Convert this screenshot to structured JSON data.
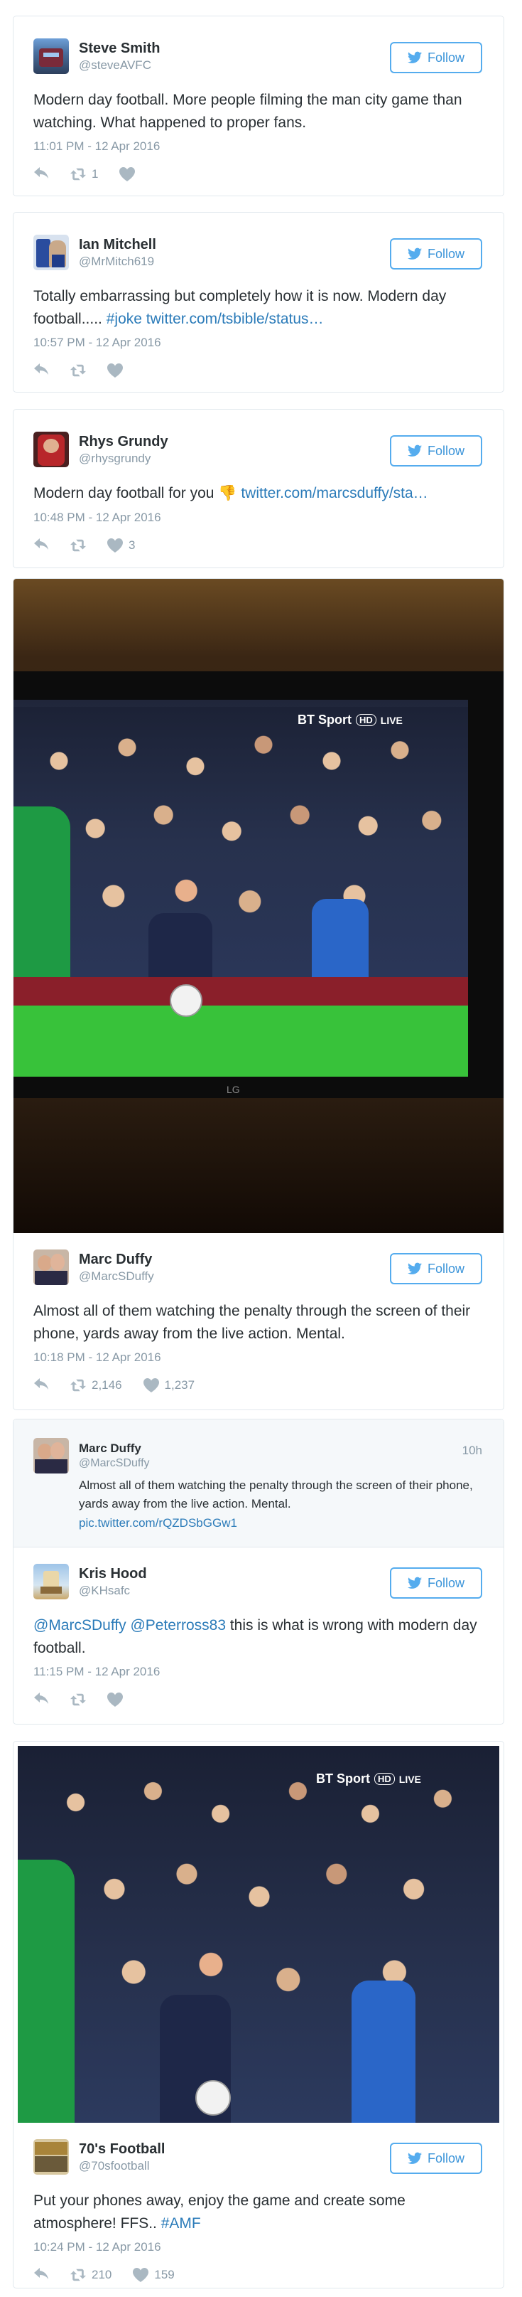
{
  "follow_label": "Follow",
  "tweets": [
    {
      "name": "Steve Smith",
      "handle": "@steveAVFC",
      "text": "Modern day football. More people filming the man city game than watching. What happened to proper fans.",
      "time": "11:01 PM - 12 Apr 2016",
      "retweets": "1",
      "likes": ""
    },
    {
      "name": "Ian Mitchell",
      "handle": "@MrMitch619",
      "text_plain": "Totally embarrassing but completely how it is now. Modern day football..... ",
      "hashtag": "#joke",
      "link": "twitter.com/tsbible/status…",
      "time": "10:57 PM - 12 Apr 2016",
      "retweets": "",
      "likes": ""
    },
    {
      "name": "Rhys Grundy",
      "handle": "@rhysgrundy",
      "text_plain": "Modern day football for you",
      "emoji": "👎",
      "link": "twitter.com/marcsduffy/sta…",
      "time": "10:48 PM - 12 Apr 2016",
      "retweets": "",
      "likes": "3"
    },
    {
      "name": "Marc Duffy",
      "handle": "@MarcSDuffy",
      "text": "Almost all of them watching the penalty through the screen of their phone, yards away from the live action. Mental.",
      "time": "10:18 PM - 12 Apr 2016",
      "retweets": "2,146",
      "likes": "1,237",
      "tv_logo": "BT Sport",
      "tv_badge": "HD",
      "tv_live": "LIVE",
      "tv_brand": "LG"
    },
    {
      "quote": {
        "name": "Marc Duffy",
        "handle": "@MarcSDuffy",
        "age": "10h",
        "text": "Almost all of them watching the penalty through the screen of their phone, yards away from the live action. Mental.",
        "link": "pic.twitter.com/rQZDSbGGw1"
      },
      "name": "Kris Hood",
      "handle": "@KHsafc",
      "mention1": "@MarcSDuffy",
      "mention2": "@Peterross83",
      "text_plain": " this is what is wrong with modern day football.",
      "time": "11:15 PM - 12 Apr 2016",
      "retweets": "",
      "likes": ""
    },
    {
      "name": "70's Football",
      "handle": "@70sfootball",
      "text_plain": "Put your phones away, enjoy the game and create some atmosphere! FFS.. ",
      "hashtag": "#AMF",
      "time": "10:24 PM - 12 Apr 2016",
      "retweets": "210",
      "likes": "159",
      "tv_logo": "BT Sport",
      "tv_badge": "HD",
      "tv_live": "LIVE"
    }
  ],
  "icons": {
    "reply": "reply-icon",
    "retweet": "retweet-icon",
    "like": "heart-icon",
    "follow": "twitter-bird-icon"
  },
  "colors": {
    "accent": "#55acee",
    "link": "#2b7bb9",
    "meta": "#8899a6",
    "text": "#292f33",
    "border": "#e1e8ed"
  }
}
